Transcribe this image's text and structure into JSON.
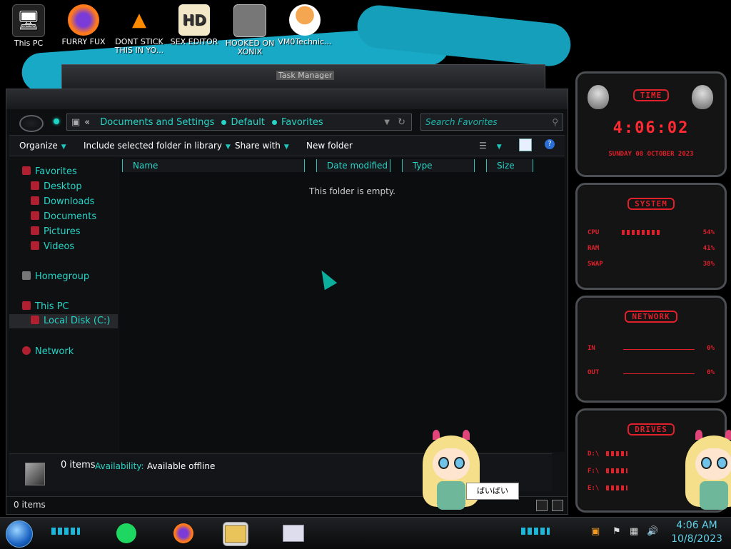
{
  "desktop_icons": [
    {
      "label": "This PC",
      "icon": "computer-icon"
    },
    {
      "label": "FURRY FUX",
      "icon": "firefox-icon"
    },
    {
      "label": "DONT STICK THIS IN YO...",
      "icon": "vlc-cone-icon"
    },
    {
      "label": "SEX EDITOR",
      "icon": "hex-editor-icon"
    },
    {
      "label": "HOOKED ON XONIX",
      "icon": "game-icon"
    },
    {
      "label": "VM0Technic...",
      "icon": "doctor-icon"
    }
  ],
  "background_window": {
    "title": "Task Manager"
  },
  "explorer": {
    "address": {
      "overflow": "«",
      "crumbs": [
        "Documents and Settings",
        "Default",
        "Favorites"
      ]
    },
    "search_placeholder": "Search Favorites",
    "commands": {
      "organize": "Organize",
      "include": "Include selected folder in library",
      "share": "Share with",
      "new_folder": "New folder"
    },
    "sidebar": {
      "favorites": "Favorites",
      "desktop": "Desktop",
      "downloads": "Downloads",
      "documents": "Documents",
      "pictures": "Pictures",
      "videos": "Videos",
      "homegroup": "Homegroup",
      "this_pc": "This PC",
      "local_disk": "Local Disk (C:)",
      "network": "Network"
    },
    "columns": [
      "Name",
      "Date modified",
      "Type",
      "Size"
    ],
    "empty_message": "This folder is empty.",
    "details": {
      "count": "0 items",
      "availability_label": "Availability:",
      "availability_value": "Available offline"
    },
    "status": "0 items"
  },
  "gadgets": {
    "time": {
      "title": "TIME",
      "clock": "4:06:02",
      "date": "SUNDAY 08 OCTOBER 2023"
    },
    "system": {
      "title": "SYSTEM",
      "rows": [
        {
          "label": "CPU",
          "value": "54%",
          "level": 0.54
        },
        {
          "label": "RAM",
          "value": "41%",
          "level": 0.41
        },
        {
          "label": "SWAP",
          "value": "38%",
          "level": 0.38
        }
      ]
    },
    "network": {
      "title": "NETWORK",
      "rows": [
        {
          "label": "IN",
          "value": "0%"
        },
        {
          "label": "OUT",
          "value": "0%"
        }
      ]
    },
    "drives": {
      "title": "DRIVES",
      "rows": [
        {
          "label": "D:\\"
        },
        {
          "label": "F:\\"
        },
        {
          "label": "E:\\"
        }
      ]
    }
  },
  "speech_bubble": "ばいばい",
  "taskbar": {
    "time": "4:06 AM",
    "date": "10/8/2023"
  }
}
